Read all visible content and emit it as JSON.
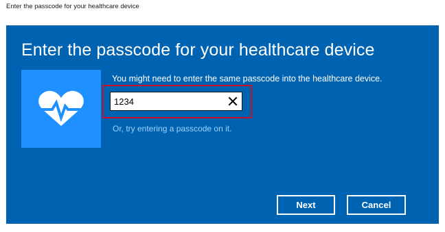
{
  "window": {
    "title": "Enter the passcode for your healthcare device"
  },
  "dialog": {
    "heading": "Enter the passcode for your healthcare device",
    "device_icon": "heart-pulse-icon",
    "instruction": "You might need to enter the same passcode into the healthcare device.",
    "passcode": {
      "value": "1234",
      "clear_icon": "close-icon"
    },
    "alt_link": "Or, try entering a passcode on it.",
    "buttons": {
      "next": "Next",
      "cancel": "Cancel"
    }
  },
  "colors": {
    "dialog_background": "#0063b1",
    "tile_background": "#1e90ff",
    "link": "#9fd2ff",
    "highlight": "#c8102e"
  }
}
